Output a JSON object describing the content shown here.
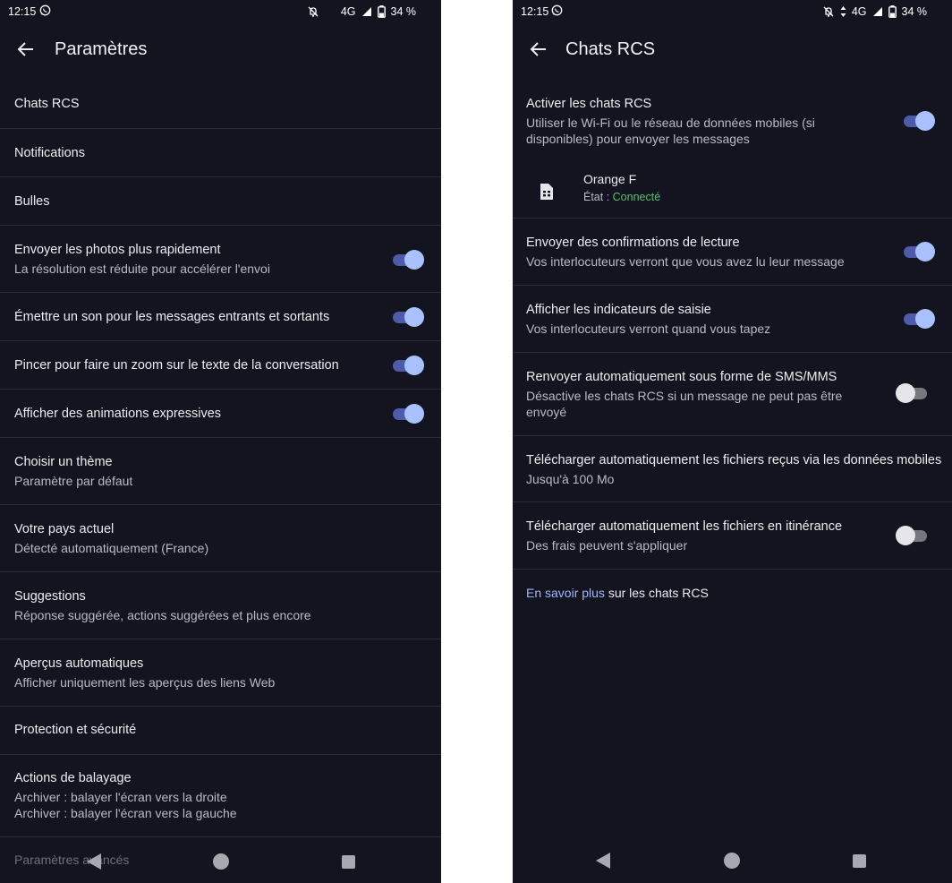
{
  "left": {
    "status": {
      "time": "12:15",
      "network": "4G",
      "battery": "34 %"
    },
    "title": "Paramètres",
    "rows": [
      {
        "title": "Chats RCS"
      },
      {
        "title": "Notifications"
      },
      {
        "title": "Bulles"
      },
      {
        "title": "Envoyer les photos plus rapidement",
        "sub": "La résolution est réduite pour accélérer l'envoi",
        "toggle": true
      },
      {
        "title": "Émettre un son pour les messages entrants et sortants",
        "toggle": true
      },
      {
        "title": "Pincer pour faire un zoom sur le texte de la conversation",
        "toggle": true
      },
      {
        "title": "Afficher des animations expressives",
        "toggle": true
      },
      {
        "title": "Choisir un thème",
        "sub": "Paramètre par défaut"
      },
      {
        "title": "Votre pays actuel",
        "sub": "Détecté automatiquement (France)"
      },
      {
        "title": "Suggestions",
        "sub": "Réponse suggérée, actions suggérées et plus encore"
      },
      {
        "title": "Aperçus automatiques",
        "sub": "Afficher uniquement les aperçus des liens Web"
      },
      {
        "title": "Protection et sécurité"
      },
      {
        "title": "Actions de balayage",
        "sub": "Archiver : balayer l'écran vers la droite",
        "sub2": "Archiver : balayer l'écran vers la gauche"
      }
    ],
    "advanced": "Paramètres avancés"
  },
  "right": {
    "status": {
      "time": "12:15",
      "network": "4G",
      "battery": "34 %"
    },
    "title": "Chats RCS",
    "enable": {
      "title": "Activer les chats RCS",
      "sub1": "Utiliser le Wi-Fi ou le réseau de données mobiles (si",
      "sub2": "disponibles) pour envoyer les messages",
      "toggle": true
    },
    "carrier": {
      "name": "Orange F",
      "state_label": "État : ",
      "state_value": "Connecté"
    },
    "rows": [
      {
        "title": "Envoyer des confirmations de lecture",
        "sub": "Vos interlocuteurs verront que vous avez lu leur message",
        "toggle": true
      },
      {
        "title": "Afficher les indicateurs de saisie",
        "sub": "Vos interlocuteurs verront quand vous tapez",
        "toggle": true
      },
      {
        "title": "Renvoyer automatiquement sous forme de SMS/MMS",
        "sub": "Désactive les chats RCS si un message ne peut pas être",
        "sub2": "envoyé",
        "toggle": false
      },
      {
        "title": "Télécharger automatiquement les fichiers reçus via les données mobiles",
        "sub": "Jusqu'à 100 Mo"
      },
      {
        "title": "Télécharger automatiquement les fichiers en itinérance",
        "sub": "Des frais peuvent s'appliquer",
        "toggle": false
      }
    ],
    "learn_more": {
      "link": "En savoir plus",
      "rest": " sur les chats RCS"
    }
  },
  "colors": {
    "background": "#131420",
    "toggle_on_thumb": "#a9c2ff",
    "toggle_on_track": "#4e5bab",
    "link": "#9fb5ff",
    "connected": "#57c06c"
  },
  "icons": [
    "whatsapp-icon",
    "mute-icon",
    "signal-icon",
    "battery-icon",
    "data-arrows-icon",
    "back-arrow-icon",
    "sim-card-icon",
    "nav-back-icon",
    "nav-home-icon",
    "nav-recents-icon"
  ]
}
